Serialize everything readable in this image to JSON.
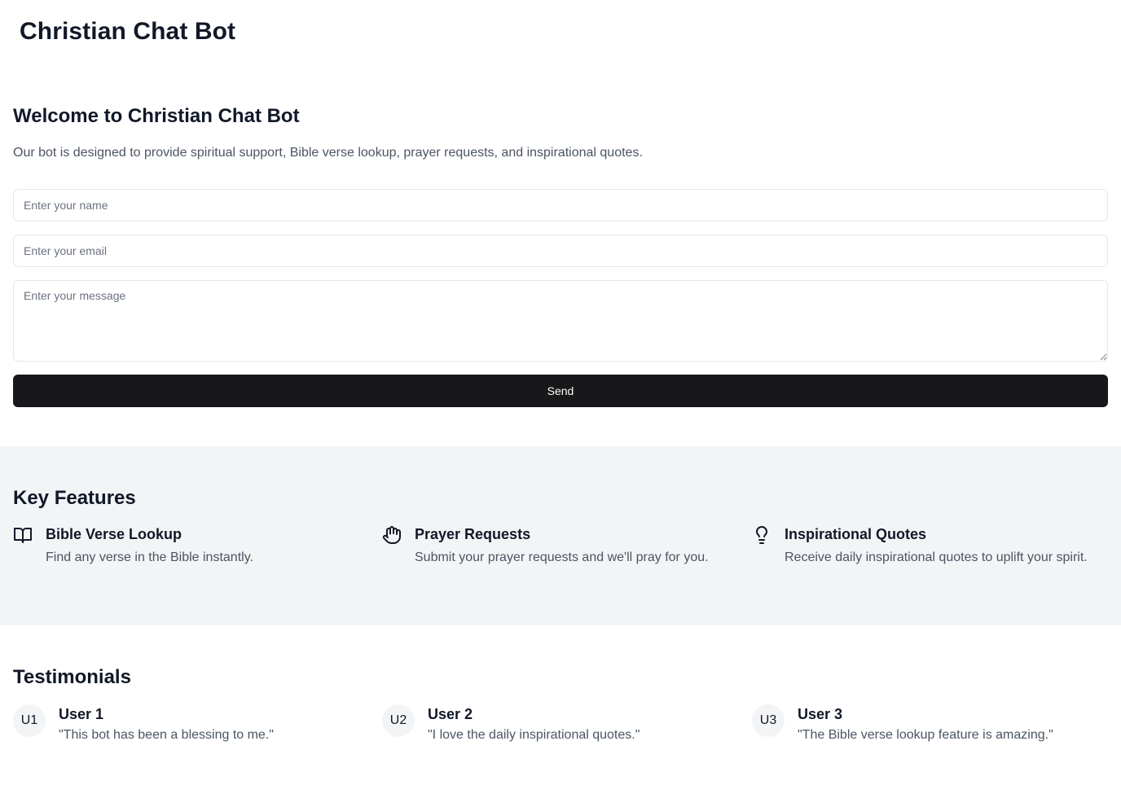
{
  "header": {
    "brand": "Christian Chat Bot"
  },
  "welcome": {
    "title": "Welcome to Christian Chat Bot",
    "description": "Our bot is designed to provide spiritual support, Bible verse lookup, prayer requests, and inspirational quotes."
  },
  "form": {
    "name_placeholder": "Enter your name",
    "name_value": "",
    "email_placeholder": "Enter your email",
    "email_value": "",
    "message_placeholder": "Enter your message",
    "message_value": "",
    "send_label": "Send"
  },
  "features": {
    "title": "Key Features",
    "items": [
      {
        "icon": "book-open-icon",
        "title": "Bible Verse Lookup",
        "description": "Find any verse in the Bible instantly."
      },
      {
        "icon": "hand-icon",
        "title": "Prayer Requests",
        "description": "Submit your prayer requests and we'll pray for you."
      },
      {
        "icon": "lightbulb-icon",
        "title": "Inspirational Quotes",
        "description": "Receive daily inspirational quotes to uplift your spirit."
      }
    ]
  },
  "testimonials": {
    "title": "Testimonials",
    "items": [
      {
        "initials": "U1",
        "name": "User 1",
        "quote": "\"This bot has been a blessing to me.\""
      },
      {
        "initials": "U2",
        "name": "User 2",
        "quote": "\"I love the daily inspirational quotes.\""
      },
      {
        "initials": "U3",
        "name": "User 3",
        "quote": "\"The Bible verse lookup feature is amazing.\""
      }
    ]
  },
  "colors": {
    "text_primary": "#111827",
    "text_muted": "#4b5563",
    "button_bg": "#18181b",
    "section_bg": "#f3f4f6"
  }
}
